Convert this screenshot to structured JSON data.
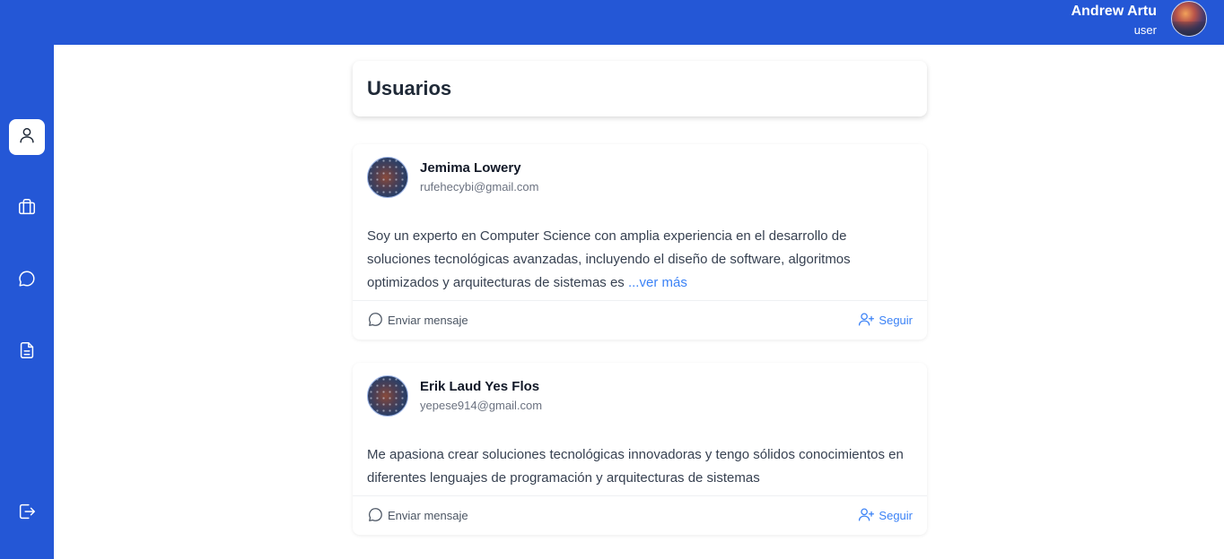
{
  "header": {
    "user_name": "Andrew Artu",
    "user_role": "user"
  },
  "sidebar": {
    "items": [
      {
        "icon": "user-icon",
        "active": true
      },
      {
        "icon": "briefcase-icon",
        "active": false
      },
      {
        "icon": "chat-bubble-icon",
        "active": false
      },
      {
        "icon": "document-icon",
        "active": false
      },
      {
        "icon": "logout-icon",
        "active": false
      }
    ]
  },
  "main": {
    "title": "Usuarios",
    "users": [
      {
        "name": "Jemima Lowery",
        "email": "rufehecybi@gmail.com",
        "bio": "Soy un experto en Computer Science con amplia experiencia en el desarrollo de soluciones tecnológicas avanzadas, incluyendo el diseño de software, algoritmos optimizados y arquitecturas de sistemas es ",
        "more": "...ver más",
        "message_label": "Enviar mensaje",
        "follow_label": "Seguir"
      },
      {
        "name": "Erik Laud Yes Flos",
        "email": "yepese914@gmail.com",
        "bio": "Me apasiona crear soluciones tecnológicas innovadoras y tengo sólidos conocimientos en diferentes lenguajes de programación y arquitecturas de sistemas",
        "more": "",
        "message_label": "Enviar mensaje",
        "follow_label": "Seguir"
      }
    ]
  },
  "colors": {
    "brand": "#2457d6",
    "link": "#3b82f6"
  }
}
